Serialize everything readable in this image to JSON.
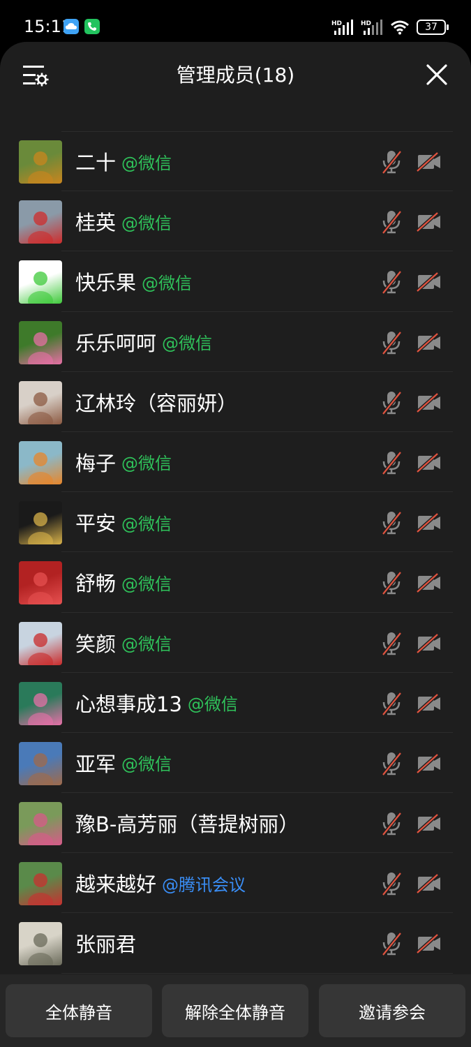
{
  "status_bar": {
    "time": "15:11",
    "battery": "37"
  },
  "header": {
    "title": "管理成员(18)"
  },
  "members": [
    {
      "name": "二十",
      "tag": "@微信",
      "tag_color": "green",
      "avatar_colors": [
        "#6a8a3a",
        "#c9851e"
      ]
    },
    {
      "name": "桂英",
      "tag": "@微信",
      "tag_color": "green",
      "avatar_colors": [
        "#8a9aa8",
        "#cf2b2b"
      ]
    },
    {
      "name": "快乐果",
      "tag": "@微信",
      "tag_color": "green",
      "avatar_colors": [
        "#ffffff",
        "#3ec93a"
      ]
    },
    {
      "name": "乐乐呵呵",
      "tag": "@微信",
      "tag_color": "green",
      "avatar_colors": [
        "#3e7a2a",
        "#e86fa6"
      ]
    },
    {
      "name": "辽林玲（容丽妍）",
      "tag": "",
      "tag_color": "green",
      "avatar_colors": [
        "#d8d0c8",
        "#8c5a42"
      ]
    },
    {
      "name": "梅子",
      "tag": "@微信",
      "tag_color": "green",
      "avatar_colors": [
        "#8bb8c8",
        "#e8862a"
      ]
    },
    {
      "name": "平安",
      "tag": "@微信",
      "tag_color": "green",
      "avatar_colors": [
        "#1a1a1a",
        "#d8b24a"
      ]
    },
    {
      "name": "舒畅",
      "tag": "@微信",
      "tag_color": "green",
      "avatar_colors": [
        "#b22222",
        "#e65050"
      ]
    },
    {
      "name": "笑颜",
      "tag": "@微信",
      "tag_color": "green",
      "avatar_colors": [
        "#c8d4e0",
        "#c92a2a"
      ]
    },
    {
      "name": "心想事成13",
      "tag": "@微信",
      "tag_color": "green",
      "avatar_colors": [
        "#2a7a5a",
        "#e870a8"
      ]
    },
    {
      "name": "亚军",
      "tag": "@微信",
      "tag_color": "green",
      "avatar_colors": [
        "#4a7ab8",
        "#a06a4a"
      ]
    },
    {
      "name": "豫B-高芳丽（菩提树丽）",
      "tag": "",
      "tag_color": "green",
      "avatar_colors": [
        "#7a9a5a",
        "#d85a8a"
      ]
    },
    {
      "name": "越来越好",
      "tag": "@腾讯会议",
      "tag_color": "blue",
      "avatar_colors": [
        "#5a8a4a",
        "#c83030"
      ]
    },
    {
      "name": "张丽君",
      "tag": "",
      "tag_color": "green",
      "avatar_colors": [
        "#d8d4c8",
        "#6a6a5a"
      ]
    }
  ],
  "bottom_buttons": {
    "mute_all": "全体静音",
    "unmute_all": "解除全体静音",
    "invite": "邀请参会"
  },
  "colors": {
    "background": "#1e1e1e",
    "tag_green": "#2fc15a",
    "tag_blue": "#3a8ef6",
    "muted_slash": "#e0533f"
  },
  "icons": [
    "settings-list-icon",
    "close-icon",
    "mic-muted-icon",
    "camera-off-icon",
    "cloud-icon",
    "phone-icon",
    "signal-icon",
    "wifi-icon",
    "battery-icon"
  ]
}
